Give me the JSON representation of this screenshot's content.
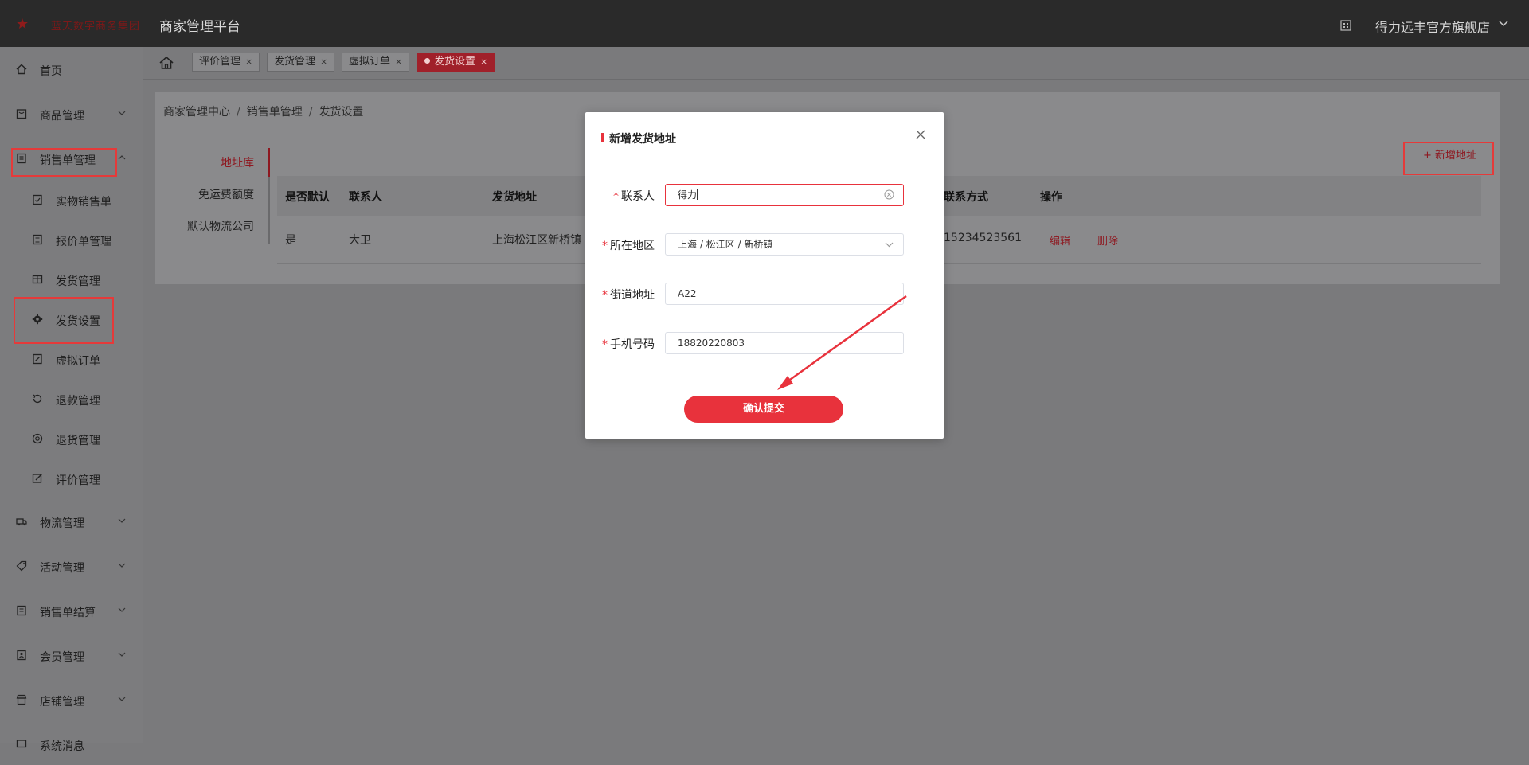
{
  "header": {
    "logo_text": "蓝天数字商务集团",
    "platform_title": "商家管理平台",
    "shop_name": "得力远丰官方旗舰店"
  },
  "sidebar": {
    "items": [
      {
        "label": "首页",
        "icon": "home-icon"
      },
      {
        "label": "商品管理",
        "icon": "goods-icon"
      },
      {
        "label": "销售单管理",
        "icon": "order-icon"
      },
      {
        "label": "物流管理",
        "icon": "logistics-icon"
      },
      {
        "label": "活动管理",
        "icon": "tag-icon"
      },
      {
        "label": "销售单结算",
        "icon": "settle-icon"
      },
      {
        "label": "会员管理",
        "icon": "member-icon"
      },
      {
        "label": "店铺管理",
        "icon": "store-icon"
      },
      {
        "label": "系统消息",
        "icon": "message-icon"
      }
    ],
    "sub_items": [
      {
        "label": "实物销售单",
        "icon": "doc-icon"
      },
      {
        "label": "报价单管理",
        "icon": "list-icon"
      },
      {
        "label": "发货管理",
        "icon": "box-icon"
      },
      {
        "label": "发货设置",
        "icon": "gear-icon"
      },
      {
        "label": "虚拟订单",
        "icon": "edit-doc-icon"
      },
      {
        "label": "退款管理",
        "icon": "refund-icon"
      },
      {
        "label": "退货管理",
        "icon": "return-icon"
      },
      {
        "label": "评价管理",
        "icon": "comment-icon"
      }
    ]
  },
  "tabs": [
    {
      "label": "评价管理",
      "close": "×"
    },
    {
      "label": "发货管理",
      "close": "×"
    },
    {
      "label": "虚拟订单",
      "close": "×"
    },
    {
      "label": "发货设置",
      "close": "×",
      "active": true
    }
  ],
  "breadcrumb": [
    "商家管理中心",
    "销售单管理",
    "发货设置"
  ],
  "breadcrumb_sep": "/",
  "vtabs": [
    "地址库",
    "免运费额度",
    "默认物流公司"
  ],
  "add_button": "+ 新增地址",
  "table": {
    "columns": [
      "是否默认",
      "联系人",
      "发货地址",
      "联系方式",
      "操作"
    ],
    "rows": [
      {
        "default": "是",
        "contact": "大卫",
        "address": "上海松江区新桥镇",
        "phone": "15234523561",
        "edit": "编辑",
        "delete": "删除"
      }
    ]
  },
  "modal": {
    "title": "新增发货地址",
    "fields": [
      {
        "label": "联系人",
        "value": "得力",
        "required": "*"
      },
      {
        "label": "所在地区",
        "value": "上海 / 松江区 / 新桥镇",
        "required": "*"
      },
      {
        "label": "街道地址",
        "value": "A22",
        "required": "*"
      },
      {
        "label": "手机号码",
        "value": "18820220803",
        "required": "*"
      }
    ],
    "submit": "确认提交"
  },
  "colors": {
    "accent": "#e8323c",
    "dark_accent": "#8e1820",
    "header_bg": "#2a2a2a",
    "highlight_box": "#e53a3a"
  }
}
